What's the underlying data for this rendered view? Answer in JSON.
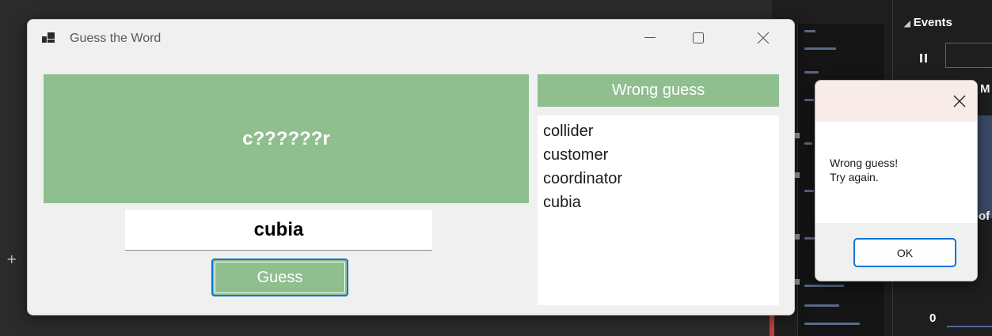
{
  "window": {
    "title": "Guess the Word",
    "controls": {
      "minimize": "minimize-icon",
      "maximize": "maximize-icon",
      "close": "close-icon"
    }
  },
  "game": {
    "masked_word": "c??????r",
    "input_value": "cubia",
    "guess_button_label": "Guess"
  },
  "wrong_guesses": {
    "header": "Wrong guess",
    "items": [
      "collider",
      "customer",
      "coordinator",
      "cubia"
    ]
  },
  "message_box": {
    "line1": "Wrong guess!",
    "line2": "Try again.",
    "ok_label": "OK"
  },
  "background": {
    "panel_header": "Events",
    "axis_zero": "0",
    "partial_letters": [
      "M",
      "of"
    ]
  },
  "colors": {
    "accent_green": "#8fbe8f",
    "focus_blue": "#0a74d6",
    "dialog_title_tint": "#f8ebe8"
  }
}
